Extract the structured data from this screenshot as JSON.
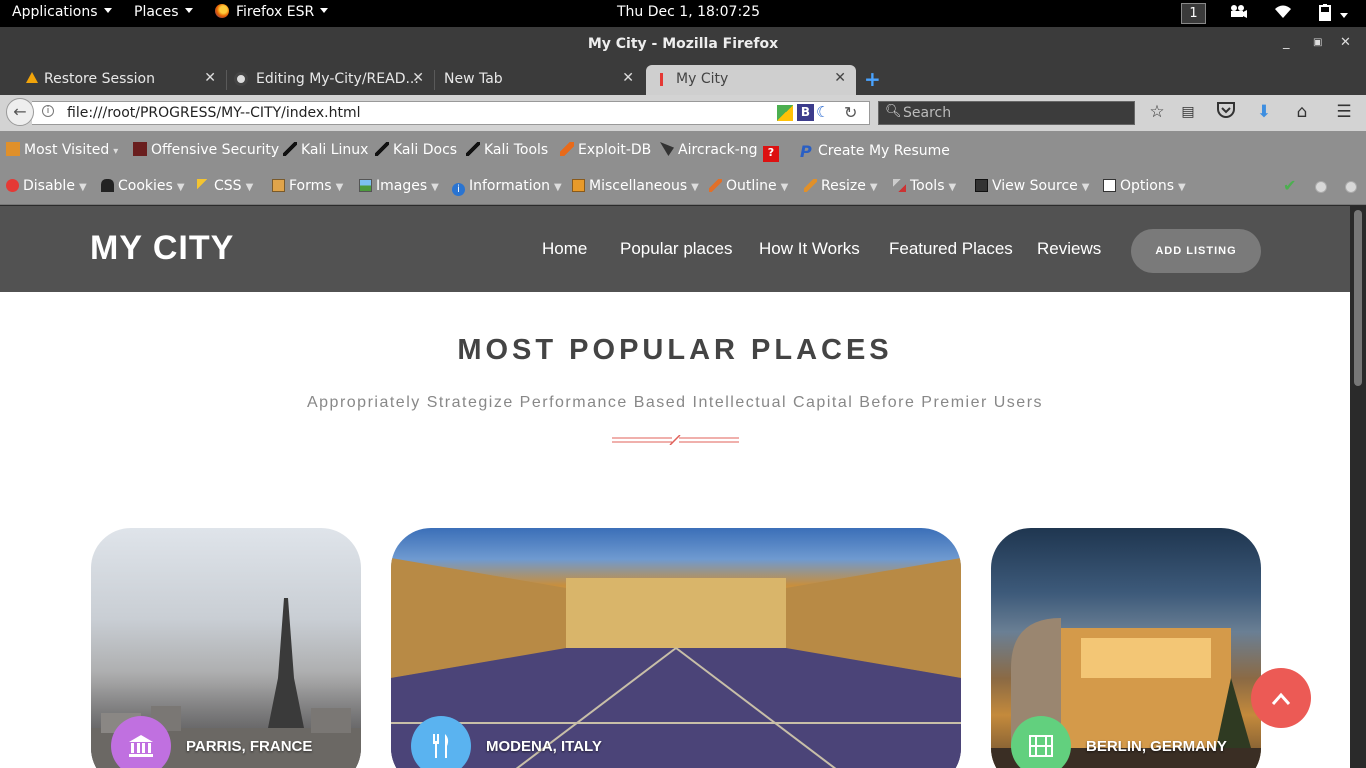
{
  "system_bar": {
    "applications": "Applications",
    "places": "Places",
    "firefox": "Firefox ESR",
    "clock": "Thu Dec  1, 18:07:25",
    "workspace": "1"
  },
  "window": {
    "title": "My City - Mozilla Firefox"
  },
  "tabs": [
    {
      "label": "Restore Session"
    },
    {
      "label": "Editing My-City/READ..."
    },
    {
      "label": "New Tab"
    },
    {
      "label": "My City"
    }
  ],
  "navbar": {
    "url": "file:///root/PROGRESS/MY--CITY/index.html",
    "search_placeholder": "Search"
  },
  "bookmarks": [
    {
      "label": "Most Visited"
    },
    {
      "label": "Offensive Security"
    },
    {
      "label": "Kali Linux"
    },
    {
      "label": "Kali Docs"
    },
    {
      "label": "Kali Tools"
    },
    {
      "label": "Exploit-DB"
    },
    {
      "label": "Aircrack-ng"
    },
    {
      "label": "Create My Resume"
    }
  ],
  "devbar": [
    {
      "label": "Disable"
    },
    {
      "label": "Cookies"
    },
    {
      "label": "CSS"
    },
    {
      "label": "Forms"
    },
    {
      "label": "Images"
    },
    {
      "label": "Information"
    },
    {
      "label": "Miscellaneous"
    },
    {
      "label": "Outline"
    },
    {
      "label": "Resize"
    },
    {
      "label": "Tools"
    },
    {
      "label": "View Source"
    },
    {
      "label": "Options"
    }
  ],
  "site": {
    "logo": "MY CITY",
    "menu": [
      "Home",
      "Popular places",
      "How It Works",
      "Featured Places",
      "Reviews"
    ],
    "cta": "ADD LISTING",
    "section_title": "MOST POPULAR PLACES",
    "section_subtitle": "Appropriately Strategize Performance Based Intellectual Capital Before Premier Users",
    "cards": [
      {
        "caption": "PARRIS, FRANCE",
        "icon": "museum-icon",
        "color": "#c070e0"
      },
      {
        "caption": "MODENA, ITALY",
        "icon": "fork-knife-icon",
        "color": "#5ab3f0"
      },
      {
        "caption": "BERLIN, GERMANY",
        "icon": "film-icon",
        "color": "#62d07e"
      }
    ]
  },
  "colors": {
    "header_bg": "#525252",
    "accent_divider": "#e0605a",
    "back_to_top": "#ec5a55"
  }
}
